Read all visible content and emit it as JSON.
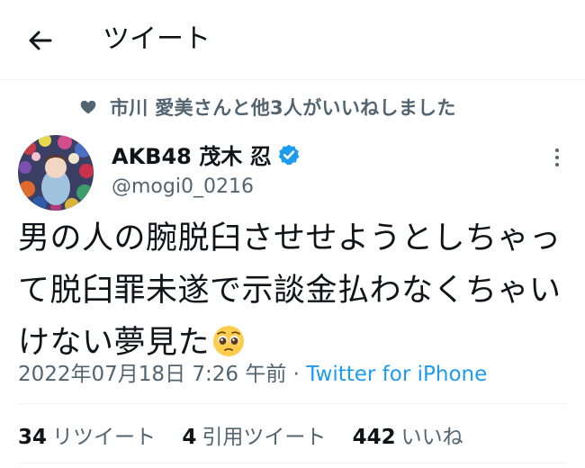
{
  "header": {
    "title": "ツイート",
    "back_icon": "arrow-left-icon"
  },
  "social_context": {
    "text": "市川 愛美さんと他3人がいいねしました",
    "icon": "heart-icon"
  },
  "author": {
    "display_name": "AKB48 茂木 忍",
    "handle": "@mogi0_0216",
    "verified": true,
    "verified_icon": "verified-badge-icon"
  },
  "tweet": {
    "text": "男の人の腕脱臼させせようとしちゃって脱臼罪未遂で示談金払わなくちゃいけない夢見た",
    "emoji": "pleading-face-emoji"
  },
  "meta": {
    "timestamp": "2022年07月18日 7:26 午前",
    "separator": "·",
    "source": "Twitter for iPhone"
  },
  "stats": {
    "retweets_count": "34",
    "retweets_label": "リツイート",
    "quotes_count": "4",
    "quotes_label": "引用ツイート",
    "likes_count": "442",
    "likes_label": "いいね"
  },
  "colors": {
    "accent": "#1d9bf0",
    "secondary_text": "#536471",
    "primary_text": "#0f1419"
  }
}
